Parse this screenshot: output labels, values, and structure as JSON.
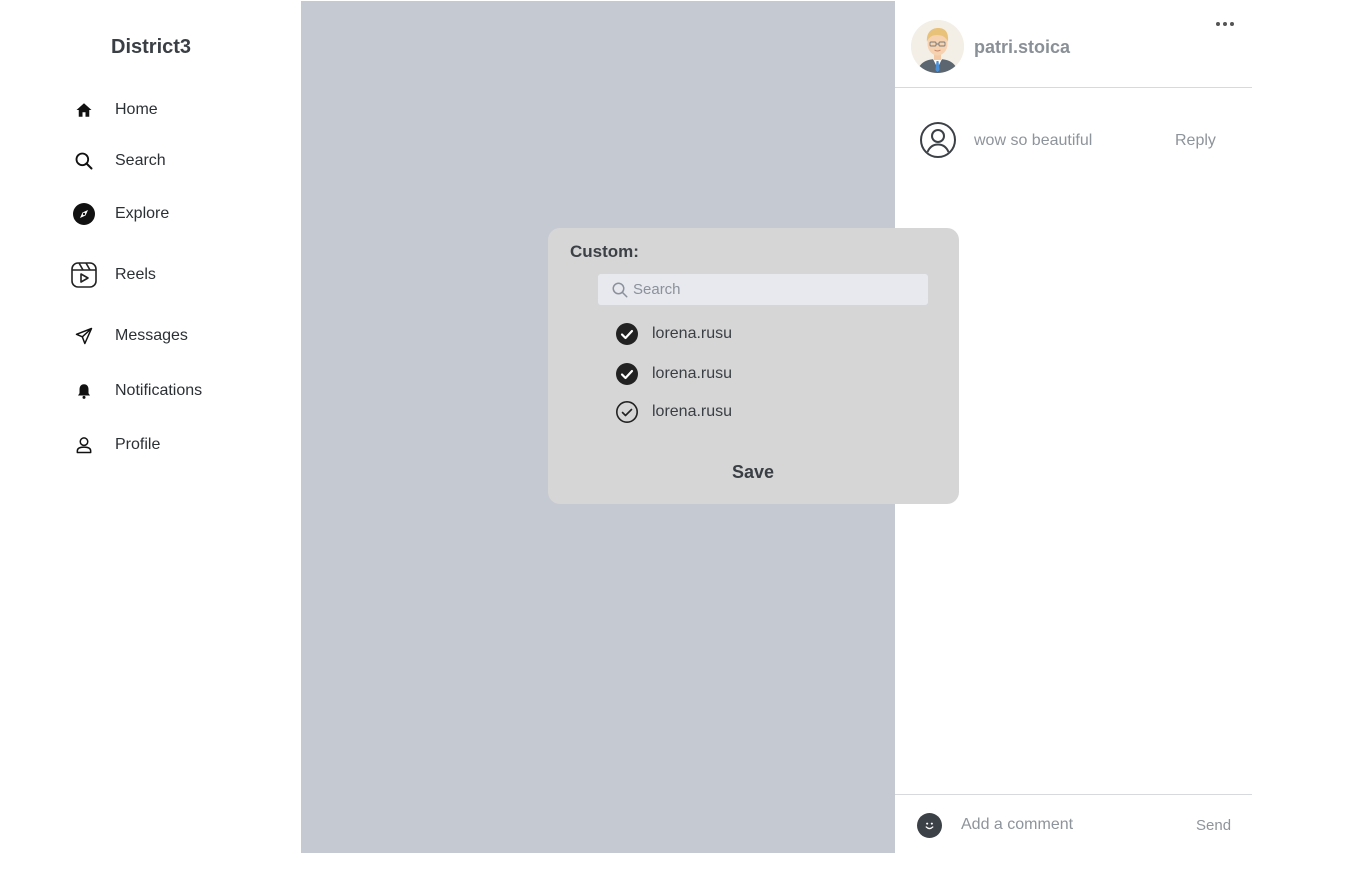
{
  "sidebar": {
    "brand": "District3",
    "items": [
      {
        "label": "Home",
        "icon": "home-icon"
      },
      {
        "label": "Search",
        "icon": "search-icon"
      },
      {
        "label": "Explore",
        "icon": "compass-icon"
      },
      {
        "label": "Reels",
        "icon": "reels-icon"
      },
      {
        "label": "Messages",
        "icon": "send-icon"
      },
      {
        "label": "Notifications",
        "icon": "bell-icon"
      },
      {
        "label": "Profile",
        "icon": "user-icon"
      }
    ]
  },
  "post": {
    "username": "patri.stoica",
    "comments": [
      {
        "text": "wow so beautiful",
        "reply_label": "Reply"
      }
    ],
    "composer": {
      "placeholder": "Add a comment",
      "send_label": "Send"
    }
  },
  "modal": {
    "title": "Custom:",
    "search_placeholder": "Search",
    "users": [
      {
        "name": "lorena.rusu",
        "selected": true
      },
      {
        "name": "lorena.rusu",
        "selected": true
      },
      {
        "name": "lorena.rusu",
        "selected": false
      }
    ],
    "save_label": "Save"
  },
  "colors": {
    "media_placeholder": "#c5c9d1",
    "modal_background": "#d6d6d6",
    "text_muted": "#8e949b"
  }
}
